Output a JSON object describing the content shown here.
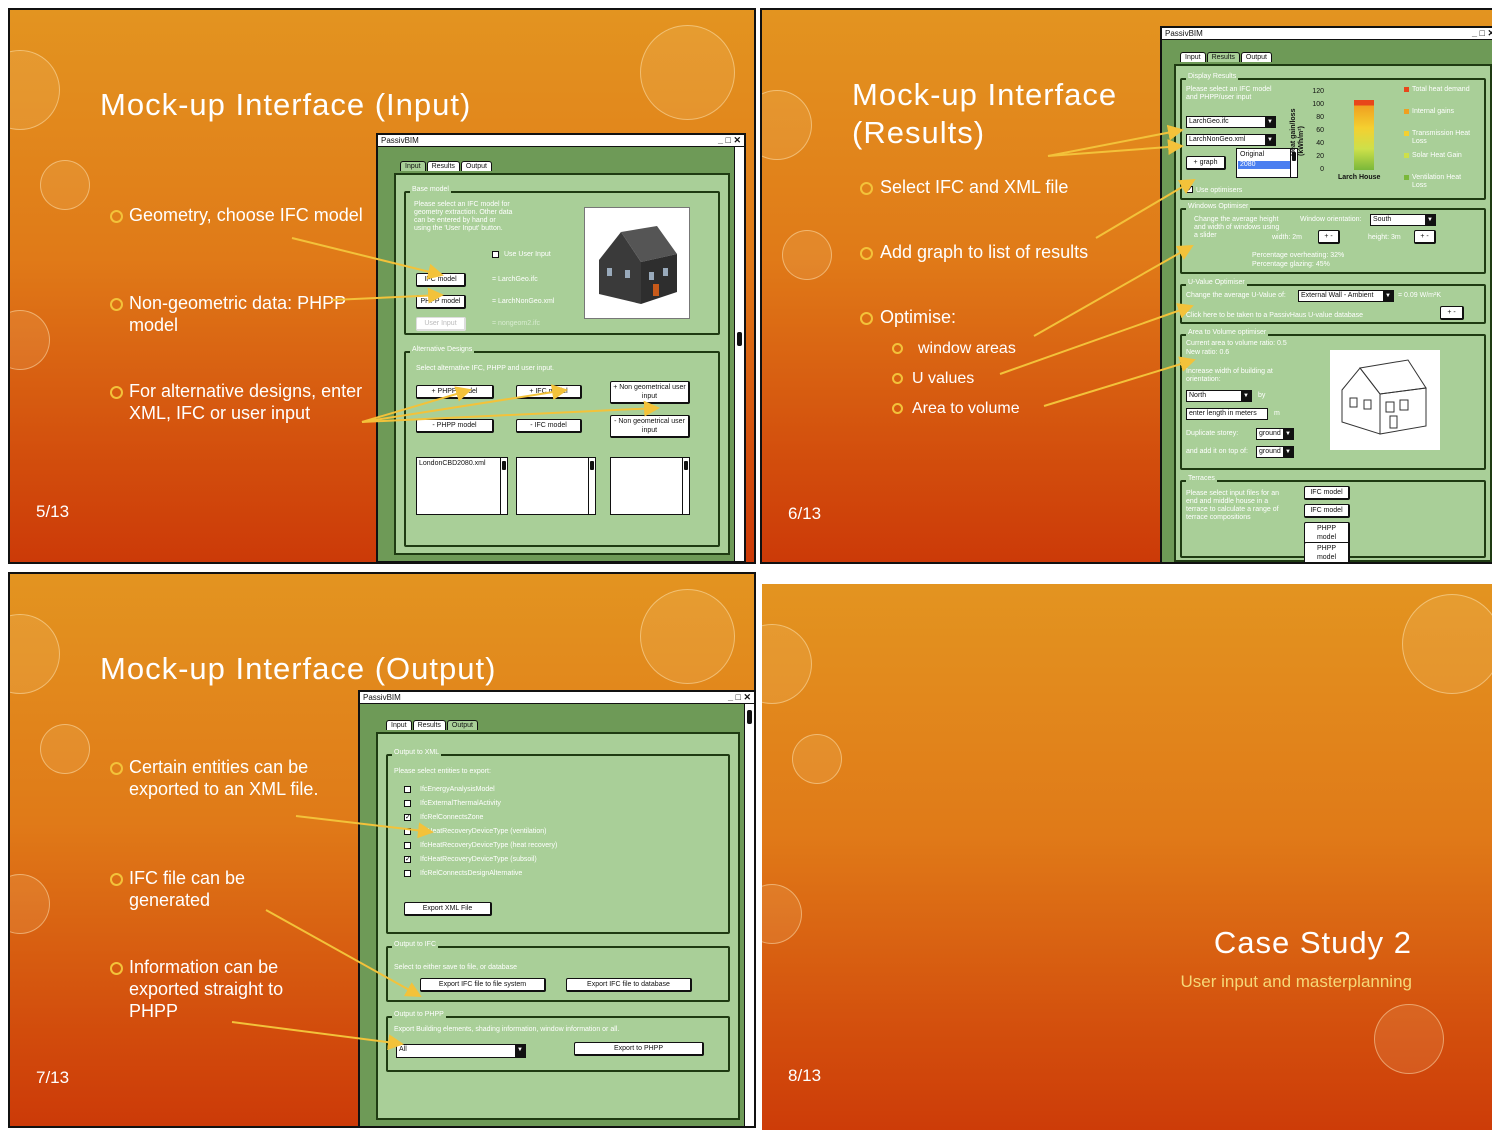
{
  "window_title": "PassivBIM",
  "window_controls": "_ □ ✕",
  "tabs": {
    "input": "Input",
    "results": "Results",
    "output": "Output"
  },
  "slide5": {
    "title": "Mock-up Interface (Input)",
    "number": "5/13",
    "bullets": [
      "Geometry, choose IFC model",
      "Non-geometric data: PHPP model",
      "For alternative designs, enter XML, IFC or user input"
    ],
    "base_model_legend": "Base model",
    "base_model_text": "Please select an IFC model for geometry extraction. Other data can be entered by hand or using the 'User Input' button.",
    "use_user_input": "Use User Input",
    "ifc_button": "IFC model",
    "phpp_button": "PHPP model",
    "user_input_button": "User Input",
    "ifc_file": "= LarchGeo.ifc",
    "phpp_file": "= LarchNonGeo.xml",
    "user_file": "= nongeom2.ifc",
    "alt_legend": "Alternative Designs",
    "alt_text": "Select alternative IFC, PHPP and user input.",
    "add_phpp": "+ PHPP model",
    "add_ifc": "+ IFC model",
    "add_nongeo": "+ Non geometrical user input",
    "rem_phpp": "- PHPP model",
    "rem_ifc": "- IFC model",
    "rem_nongeo": "- Non geometrical user input",
    "list_item": "LondonCBD2080.xml"
  },
  "slide6": {
    "title": "Mock-up Interface (Results)",
    "number": "6/13",
    "bullets": [
      "Select IFC and XML file",
      "Add graph to list of results",
      "Optimise:"
    ],
    "sub_bullets": [
      "window areas",
      "U values",
      "Area to volume"
    ],
    "display_legend": "Display Results",
    "display_text": "Please select an IFC model and PHPP/user input",
    "dd1": "LarchGeo.ifc",
    "dd2": "LarchNonGeo.xml",
    "add_graph": "+ graph",
    "list_items": [
      "Original",
      "2080"
    ],
    "use_optimisers": "Use optimisers",
    "chart_ylabel": "Heat gain/loss (kWh/m²)",
    "chart_xlabel": "Larch House",
    "chart_ticks": [
      "120",
      "100",
      "80",
      "60",
      "40",
      "20",
      "0"
    ],
    "legend": [
      "Total heat demand",
      "Internal gains",
      "Transmission Heat Loss",
      "Solar Heat Gain",
      "Ventilation Heat Loss"
    ],
    "legend_colors": [
      "#e8461a",
      "#f0a020",
      "#f4d030",
      "#cde04a",
      "#7ab83a"
    ],
    "win_legend": "Windows Optimiser",
    "win_text": "Change the average height and width of windows using a slider",
    "win_orient": "Window orientation:",
    "win_orient_val": "South",
    "width": "width:  2m",
    "height": "height:  3m",
    "overheat": "Percentage overheating: 32%",
    "glazing": "Percentage glazing: 45%",
    "u_legend": "U-Value Optimiser",
    "u_text": "Change the average U-Value of:",
    "u_dd": "External Wall - Ambient",
    "u_val": "= 0.09 W/m²K",
    "u_link": "Click here to be taken to a PassivHaus U-value database",
    "av_legend": "Area to Volume optimiser",
    "av_current": "Current area to volume ratio: 0.5",
    "av_new": "New ratio: 0.6",
    "av_increase": "Increase width of building at orientation:",
    "av_dir": "North",
    "av_by": "by",
    "av_len": "enter length in meters",
    "av_m": "m",
    "av_dup": "Duplicate storey:",
    "av_ground": "ground",
    "av_add": "and add it on top of:",
    "terr_legend": "Terraces",
    "terr_text": "Please select input files for an end and middle house in a terrace to calculate a range of terrace compositions",
    "terr_buttons": [
      "IFC model",
      "IFC model",
      "PHPP model",
      "PHPP model"
    ]
  },
  "slide7": {
    "title": "Mock-up Interface (Output)",
    "number": "7/13",
    "bullets": [
      "Certain entities can be exported to an XML file.",
      "IFC file can be generated",
      "Information can be exported straight to PHPP"
    ],
    "xml_legend": "Output to XML",
    "xml_text": "Please select entities to export:",
    "entities": [
      "IfcEnergyAnalysisModel",
      "IfcExternalThermalActivity",
      "IfcRelConnectsZone",
      "IfcHeatRecoveryDeviceType (ventilation)",
      "IfcHeatRecoveryDeviceType (heat recovery)",
      "IfcHeatRecoveryDeviceType (subsoil)",
      "IfcRelConnectsDesignAlternative"
    ],
    "checked": [
      false,
      false,
      true,
      false,
      false,
      true,
      false
    ],
    "export_xml": "Export XML File",
    "ifc_legend": "Output to IFC",
    "ifc_text": "Select to either save to file, or database",
    "export_ifc_file": "Export IFC file to file system",
    "export_ifc_db": "Export IFC file to database",
    "phpp_legend": "Output to PHPP",
    "phpp_text": "Export Building elements, shading information, window information or all.",
    "phpp_dd": "All",
    "export_phpp": "Export to PHPP"
  },
  "slide8": {
    "title": "Case Study 2",
    "subtitle": "User input and masterplanning",
    "number": "8/13"
  },
  "colors": {
    "accent": "#f3c23a",
    "window_green": "#6e9a57",
    "panel_green": "#a9cf98"
  }
}
